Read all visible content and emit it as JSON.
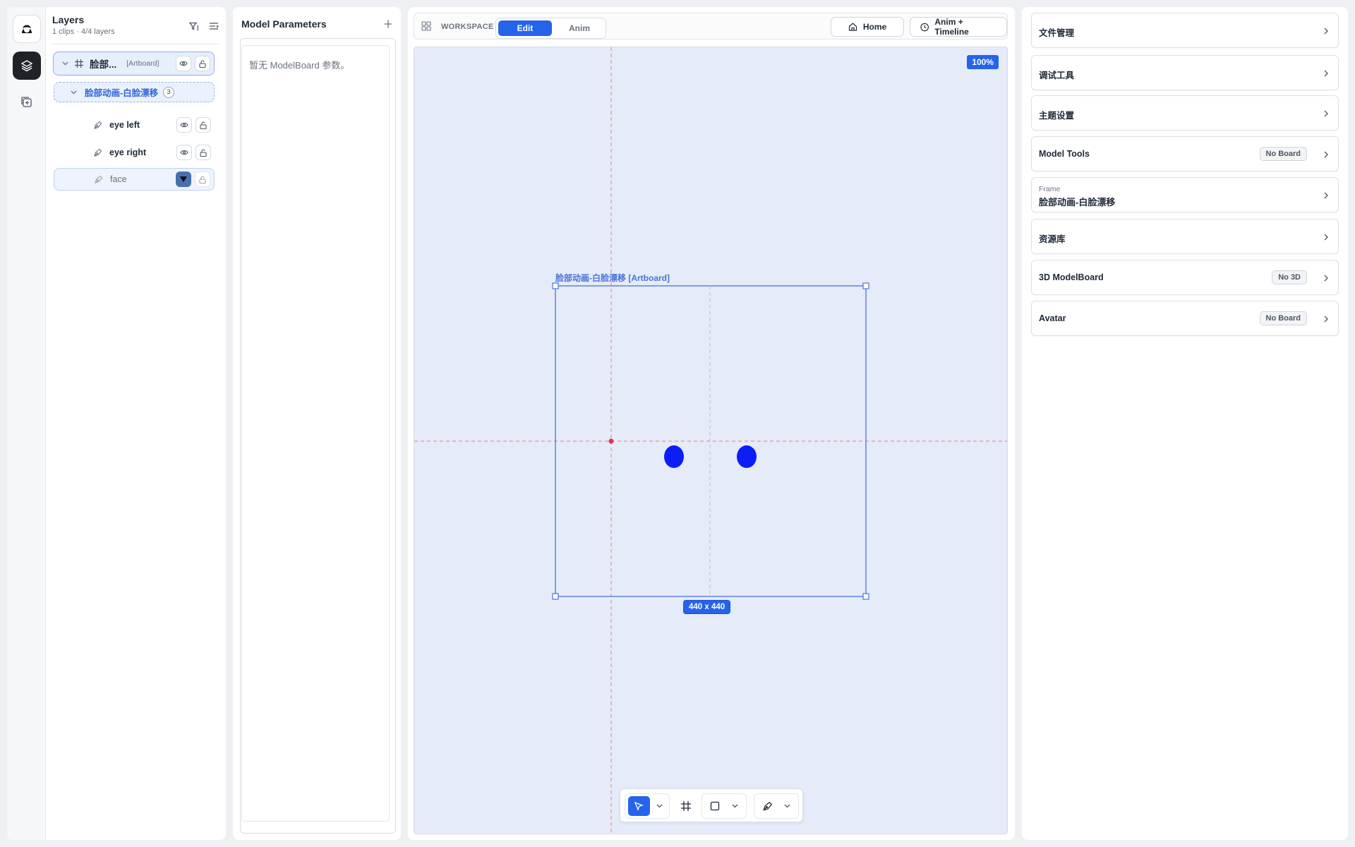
{
  "layers": {
    "title": "Layers",
    "subtitle": "1 clips · 4/4 layers",
    "artboard": {
      "name": "脸部...",
      "tag": "[Artboard]"
    },
    "group": {
      "name": "脸部动画-白脸漂移",
      "count": "3"
    },
    "items": [
      {
        "name": "eye left"
      },
      {
        "name": "eye right"
      },
      {
        "name": "face"
      }
    ]
  },
  "params": {
    "title": "Model Parameters",
    "empty_text": "暂无 ModelBoard 参数。"
  },
  "workspace": {
    "label": "WORKSPACE",
    "modes": [
      "Edit",
      "Anim"
    ],
    "active_mode": "Edit",
    "home_label": "Home",
    "timeline_label": "Anim + Timeline",
    "zoom": "100%",
    "artboard_label": "脸部动画-白脸漂移 [Artboard]",
    "artboard_size": "440 x 440"
  },
  "right": {
    "cards": [
      {
        "title": "文件管理"
      },
      {
        "title": "调试工具"
      },
      {
        "title": "主题设置"
      },
      {
        "title": "Model Tools",
        "badge": "No Board"
      },
      {
        "kicker": "Frame",
        "title": "脸部动画-白脸漂移"
      },
      {
        "title": "资源库"
      },
      {
        "title": "3D ModelBoard",
        "badge": "No 3D"
      },
      {
        "title": "Avatar",
        "badge": "No Board"
      }
    ]
  },
  "colors": {
    "accent": "#2563eb",
    "eye": "#0a1ef5",
    "guide": "#e8788a",
    "canvas": "#e5ebf8"
  }
}
